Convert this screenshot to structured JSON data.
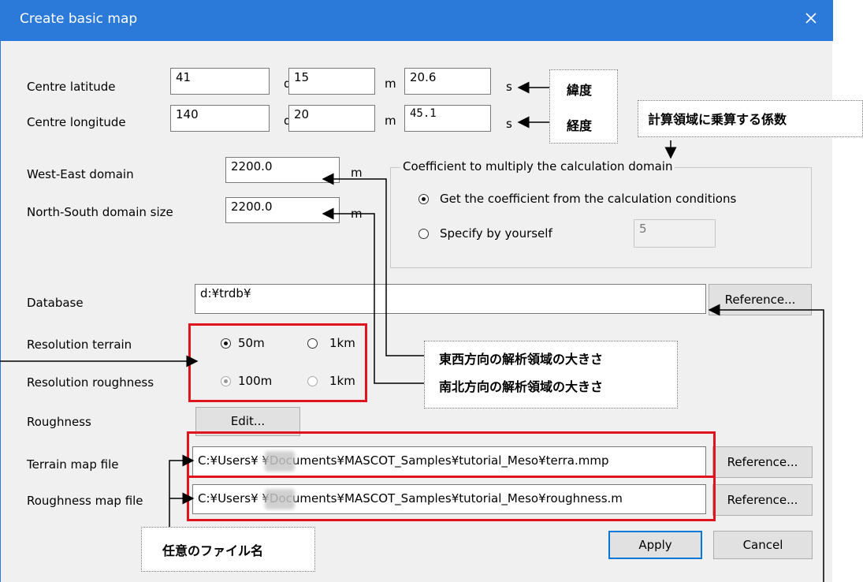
{
  "dialog": {
    "title": "Create basic map",
    "close_icon": "close-icon"
  },
  "latitude": {
    "label": "Centre latitude",
    "deg": "41",
    "deg_unit": "d",
    "min": "15",
    "min_unit": "m",
    "sec": "20.6",
    "sec_unit": "s"
  },
  "longitude": {
    "label": "Centre longitude",
    "deg": "140",
    "deg_unit": "d",
    "min": "20",
    "min_unit": "m",
    "sec": "45.1",
    "sec_unit": "s"
  },
  "domain": {
    "we_label": "West-East domain",
    "we_value": "2200.0",
    "we_unit": "m",
    "ns_label": "North-South domain size",
    "ns_value": "2200.0",
    "ns_unit": "m"
  },
  "coefficient": {
    "group_title": "Coefficient to multiply the calculation domain",
    "option_conditions": "Get the coefficient from the calculation conditions",
    "option_specify": "Specify by yourself",
    "specify_value": "5"
  },
  "database": {
    "label": "Database",
    "value": "d:¥trdb¥",
    "reference": "Reference..."
  },
  "resolution": {
    "terrain_label": "Resolution terrain",
    "terrain_opt1": "50m",
    "terrain_opt2": "1km",
    "roughness_label": "Resolution roughness",
    "roughness_opt1": "100m",
    "roughness_opt2": "1km"
  },
  "roughness": {
    "label": "Roughness",
    "edit": "Edit..."
  },
  "terrain_file": {
    "label": "Terrain map file",
    "value": "C:¥Users¥      ¥Documents¥MASCOT_Samples¥tutorial_Meso¥terra.mmp",
    "reference": "Reference..."
  },
  "roughness_file": {
    "label": "Roughness map file",
    "value": "C:¥Users¥      ¥Documents¥MASCOT_Samples¥tutorial_Meso¥roughness.m",
    "reference": "Reference..."
  },
  "buttons": {
    "apply": "Apply",
    "cancel": "Cancel"
  },
  "annotations": {
    "latitude_jp": "緯度",
    "longitude_jp": "経度",
    "coefficient_jp": "計算領域に乗算する係数",
    "we_jp": "東西方向の解析領域の大きさ",
    "ns_jp": "南北方向の解析領域の大きさ",
    "filename_jp": "任意のファイル名"
  },
  "colors": {
    "titlebar": "#2b79d8",
    "highlight": "#e0141e",
    "dialog_bg": "#f0f0f0"
  }
}
